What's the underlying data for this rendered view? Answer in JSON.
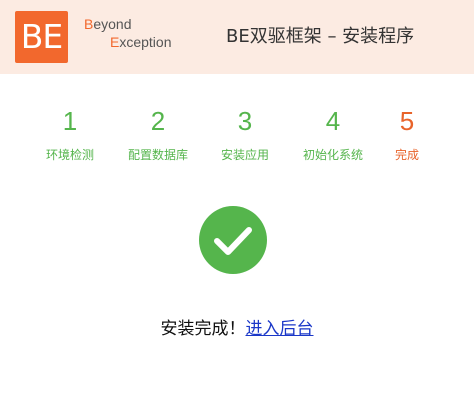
{
  "header": {
    "logo_letters": "BE",
    "logo_line1_cap": "B",
    "logo_line1_rest": "eyond",
    "logo_line2_cap": "E",
    "logo_line2_rest": "xception",
    "title": "BE双驱框架 – 安装程序",
    "bg_color": "#fcebe2",
    "brand_color": "#f2682d"
  },
  "steps": [
    {
      "number": "1",
      "label": "环境检测",
      "status": "complete"
    },
    {
      "number": "2",
      "label": "配置数据库",
      "status": "complete"
    },
    {
      "number": "3",
      "label": "安装应用",
      "status": "complete"
    },
    {
      "number": "4",
      "label": "初始化系统",
      "status": "complete"
    },
    {
      "number": "5",
      "label": "完成",
      "status": "current"
    }
  ],
  "colors": {
    "complete": "#55b54c",
    "current": "#e8632a",
    "link": "#1a37c8"
  },
  "result": {
    "icon": "check-circle-icon",
    "message": "安装完成！",
    "link_label": "进入后台"
  }
}
